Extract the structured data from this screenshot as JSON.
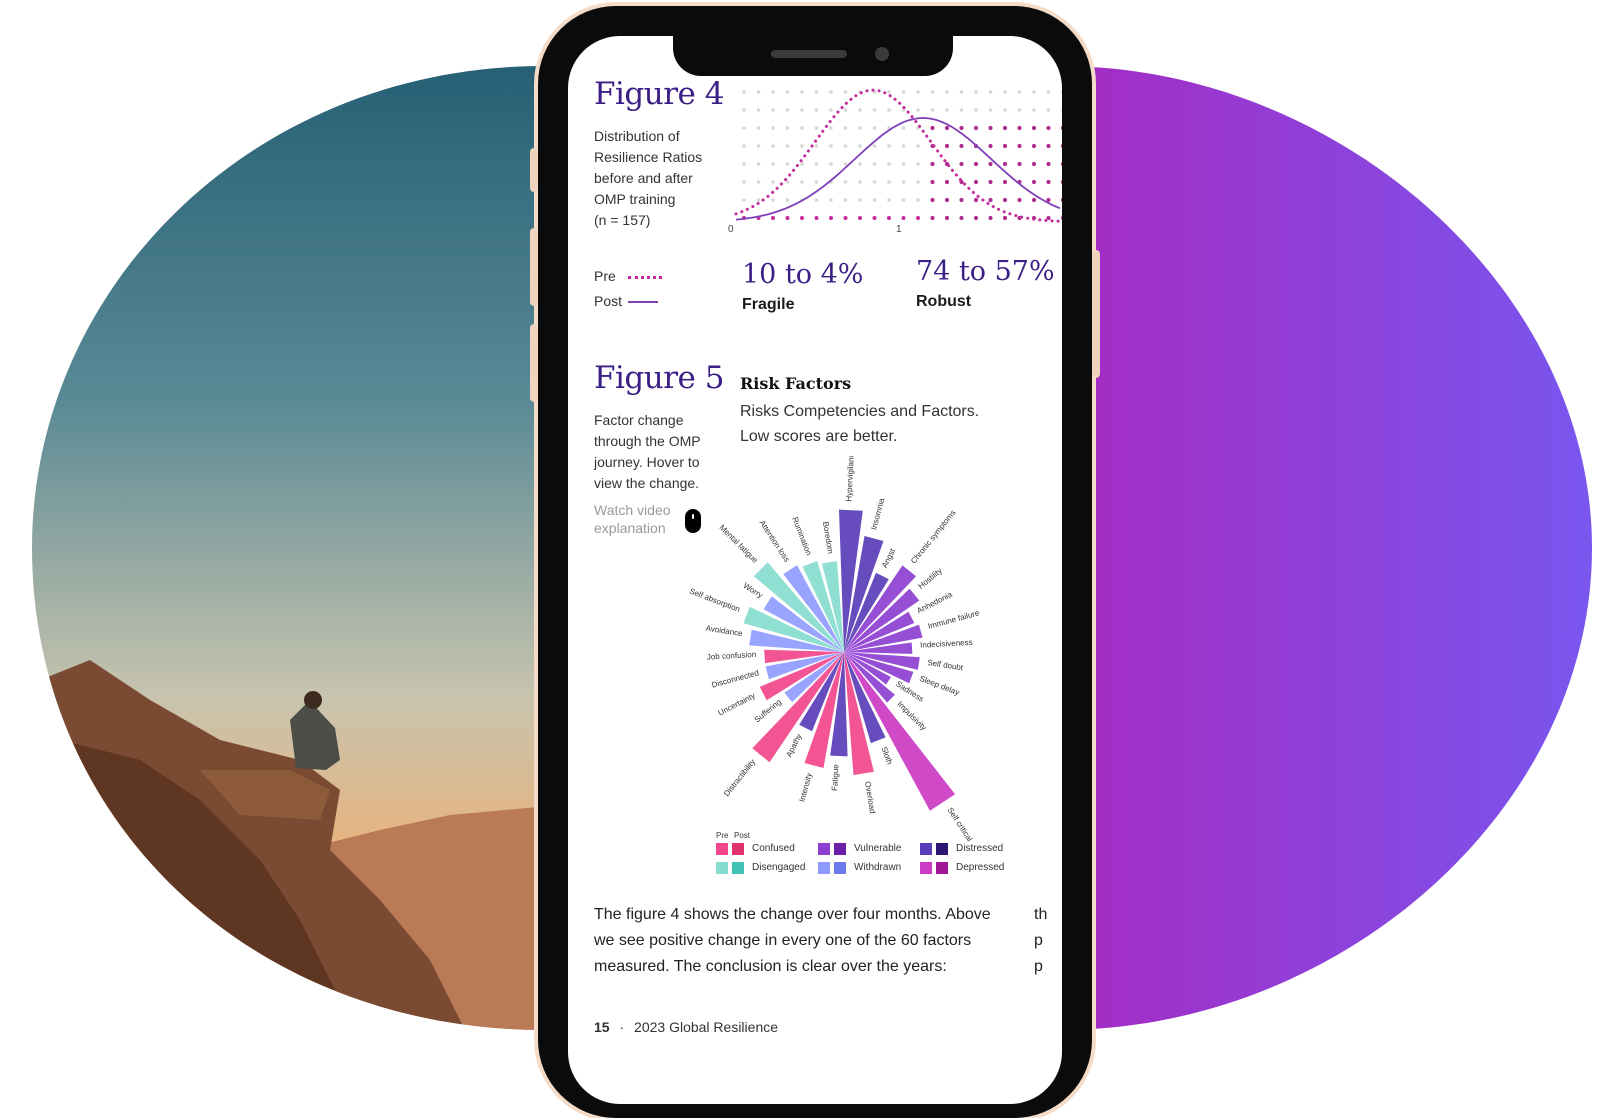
{
  "colors": {
    "purple_dark": "#3b1f86",
    "accent_magenta": "#c42a9c",
    "blob_left": "#a52bc2",
    "blob_right": "#7956ef"
  },
  "figure4": {
    "title": "Figure 4",
    "description": [
      "Distribution of",
      "Resilience Ratios",
      "before and after",
      "OMP training",
      "(n = 157)"
    ],
    "axis_ticks": [
      "0",
      "1"
    ],
    "legend": {
      "pre": "Pre",
      "post": "Post"
    },
    "stat_fragile": {
      "value": "10 to 4%",
      "label": "Fragile"
    },
    "stat_robust": {
      "value": "74 to 57%",
      "label": "Robust"
    }
  },
  "figure5": {
    "title": "Figure 5",
    "description": [
      "Factor change",
      "through the OMP",
      "journey. Hover to",
      "view the change."
    ],
    "video_link": [
      "Watch video",
      "explanation"
    ],
    "heading": "Risk Factors",
    "subheading": [
      "Risks Competencies and Factors.",
      "Low scores are better."
    ],
    "legend_header": {
      "pre": "Pre",
      "post": "Post"
    },
    "legend_items": [
      {
        "label": "Confused",
        "pre": "#f2478b",
        "post": "#e0336e"
      },
      {
        "label": "Vulnerable",
        "pre": "#8d3fd0",
        "post": "#6a1fa8"
      },
      {
        "label": "Distressed",
        "pre": "#5a3db8",
        "post": "#2e1675"
      },
      {
        "label": "Disengaged",
        "pre": "#85dccf",
        "post": "#40c2b4"
      },
      {
        "label": "Withdrawn",
        "pre": "#8f9cff",
        "post": "#6c7af0"
      },
      {
        "label": "Depressed",
        "pre": "#cc3bc3",
        "post": "#a01795"
      }
    ]
  },
  "chart_data": [
    {
      "type": "line",
      "x_ticks": [
        "0",
        "1"
      ],
      "series": [
        {
          "name": "Pre",
          "style": "dotted",
          "color": "#c42a9c"
        },
        {
          "name": "Post",
          "style": "solid",
          "color": "#7f3fb8"
        }
      ]
    },
    {
      "type": "bar",
      "polar": true,
      "title": "Risk Factors",
      "categories": [
        "Hypervigilance",
        "Insomnia",
        "Angst",
        "Chronic symptoms",
        "Hostility",
        "Anhedonia",
        "Immune failure",
        "Indecisiveness",
        "Self doubt",
        "Sleep delay",
        "Sadness",
        "Impulsivity",
        "Self critical",
        "Sloth",
        "Overload",
        "Fatigue",
        "Intensity",
        "Apathy",
        "Distractibility",
        "Suffering",
        "Uncertainty",
        "Disconnected",
        "Job confusion",
        "Avoidance",
        "Self absorption",
        "Worry",
        "Mental fatigue",
        "Attention loss",
        "Rumination",
        "Boredom"
      ],
      "values": [
        0.75,
        0.62,
        0.45,
        0.55,
        0.48,
        0.4,
        0.42,
        0.36,
        0.4,
        0.38,
        0.28,
        0.35,
        0.95,
        0.5,
        0.65,
        0.55,
        0.62,
        0.45,
        0.7,
        0.38,
        0.48,
        0.42,
        0.42,
        0.5,
        0.55,
        0.48,
        0.62,
        0.52,
        0.5,
        0.48
      ],
      "groups": [
        "Distressed",
        "Distressed",
        "Distressed",
        "Vulnerable",
        "Vulnerable",
        "Vulnerable",
        "Vulnerable",
        "Vulnerable",
        "Vulnerable",
        "Vulnerable",
        "Vulnerable",
        "Vulnerable",
        "Depressed",
        "Distressed",
        "Confused",
        "Distressed",
        "Confused",
        "Distressed",
        "Confused",
        "Withdrawn",
        "Confused",
        "Withdrawn",
        "Confused",
        "Withdrawn",
        "Disengaged",
        "Withdrawn",
        "Disengaged",
        "Withdrawn",
        "Disengaged",
        "Disengaged"
      ]
    }
  ],
  "body_text": [
    "The figure 4 shows the change over four months. Above",
    "we see positive change in every one of the 60 factors",
    "measured. The conclusion is clear over the years:"
  ],
  "cutoff_letters": [
    "th",
    "p",
    "p"
  ],
  "footer": {
    "page": "15",
    "sep": "·",
    "title": "2023 Global Resilience"
  }
}
